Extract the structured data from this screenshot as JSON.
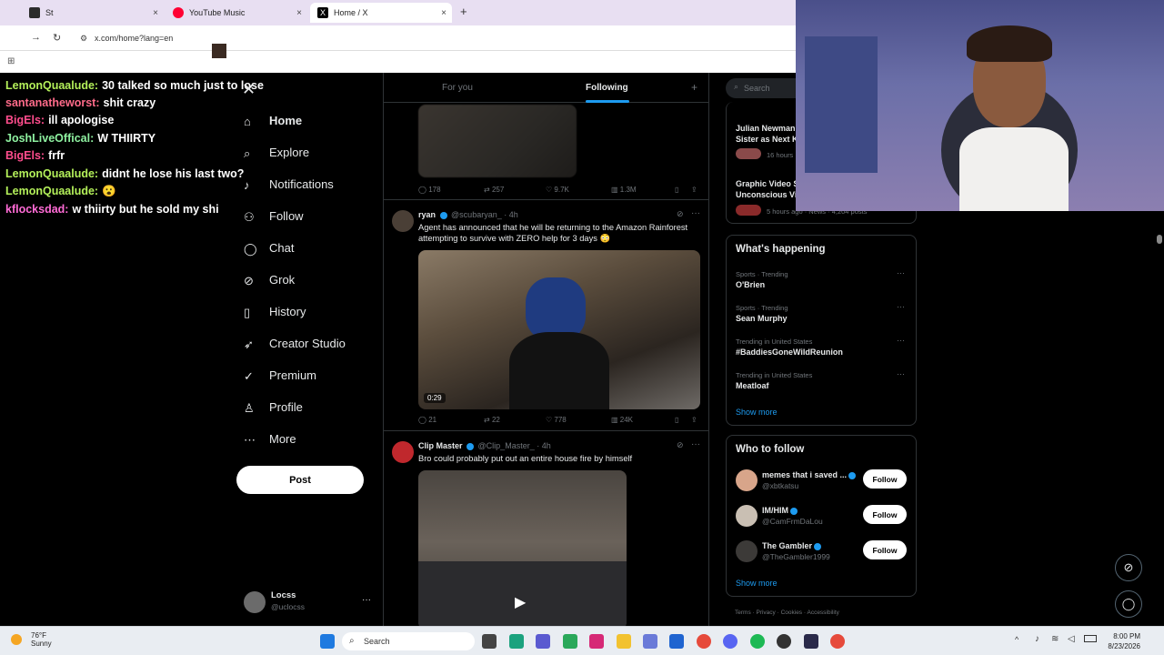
{
  "browser": {
    "tabs": [
      {
        "label": "St",
        "close": "×"
      },
      {
        "label": "YouTube Music",
        "close": "×"
      },
      {
        "label": "Home / X",
        "close": "×"
      }
    ],
    "new_tab": "+",
    "url": "x.com/home?lang=en"
  },
  "chat": [
    {
      "user": "LemonQuaalude:",
      "color": "#b4f05a",
      "msg": "30 talked so much just to lose"
    },
    {
      "user": "santanatheworst:",
      "color": "#ff6b8a",
      "msg": "shit crazy"
    },
    {
      "user": "BigEls:",
      "color": "#ff4d8d",
      "msg": "ill apologise"
    },
    {
      "user": "JoshLiveOffical:",
      "color": "#8ef0a0",
      "msg": "W THIIRTY"
    },
    {
      "user": "BigEls:",
      "color": "#ff4d8d",
      "msg": "frfr"
    },
    {
      "user": "LemonQuaalude:",
      "color": "#b4f05a",
      "msg": "didnt he lose his last two?"
    },
    {
      "user": "LemonQuaalude:",
      "color": "#b4f05a",
      "msg": "😮"
    },
    {
      "user": "kflocksdad:",
      "color": "#ff6bd6",
      "msg": "w thiirty but he sold my shi"
    }
  ],
  "nav": {
    "items": [
      "Home",
      "Explore",
      "Notifications",
      "Follow",
      "Chat",
      "Grok",
      "History",
      "Creator Studio",
      "Premium",
      "Profile",
      "More"
    ],
    "post": "Post",
    "account_name": "Locss",
    "account_handle": "@uclocss",
    "account_more": "···"
  },
  "timeline": {
    "tabs": [
      "For you",
      "Following"
    ],
    "tab_plus": "+",
    "tweets": [
      {
        "replies": "178",
        "retweets": "257",
        "likes": "9.7K",
        "views": "1.3M"
      },
      {
        "name": "ryan",
        "handle": "@scubaryan_",
        "time": "· 4h",
        "text": "Agent has announced that he will be returning to the Amazon Rainforest attempting to survive with ZERO help for 3 days 😳",
        "duration": "0:29",
        "replies": "21",
        "retweets": "22",
        "likes": "778",
        "views": "24K"
      },
      {
        "name": "Clip Master",
        "handle": "@Clip_Master_",
        "time": "· 4h",
        "text": "Bro could probably put out an entire house fire by himself"
      }
    ]
  },
  "search": {
    "placeholder": "Search"
  },
  "news": [
    {
      "title": "Julian Newman",
      "subtitle": "Sister as Next K",
      "meta": "16 hours"
    },
    {
      "title": "Graphic Video S",
      "subtitle": "Unconscious Vi",
      "meta": "5 hours ago · News · 4,204 posts"
    }
  ],
  "happening": {
    "title": "What's happening",
    "trends": [
      {
        "meta": "Sports · Trending",
        "name": "O'Brien"
      },
      {
        "meta": "Sports · Trending",
        "name": "Sean Murphy"
      },
      {
        "meta": "Trending in United States",
        "name": "#BaddiesGoneWildReunion"
      },
      {
        "meta": "Trending in United States",
        "name": "Meatloaf"
      }
    ],
    "more": "···",
    "show_more": "Show more"
  },
  "who_to_follow": {
    "title": "Who to follow",
    "accounts": [
      {
        "name": "memes that i saved ...",
        "handle": "@xbtkatsu"
      },
      {
        "name": "IM/HIM",
        "handle": "@CamFrmDaLou"
      },
      {
        "name": "The Gambler",
        "handle": "@TheGambler1999"
      }
    ],
    "follow_label": "Follow",
    "show_more": "Show more"
  },
  "footer": [
    "Terms",
    "Privacy",
    "Cookies",
    "Accessibility"
  ],
  "taskbar": {
    "temp": "76°F",
    "weather": "Sunny",
    "search": "Search",
    "time": "8:00 PM",
    "date": "8/23/2026"
  },
  "colors": {
    "accent": "#1d9bf0",
    "bg": "#000000",
    "border": "#2f3336",
    "muted": "#71767b"
  }
}
